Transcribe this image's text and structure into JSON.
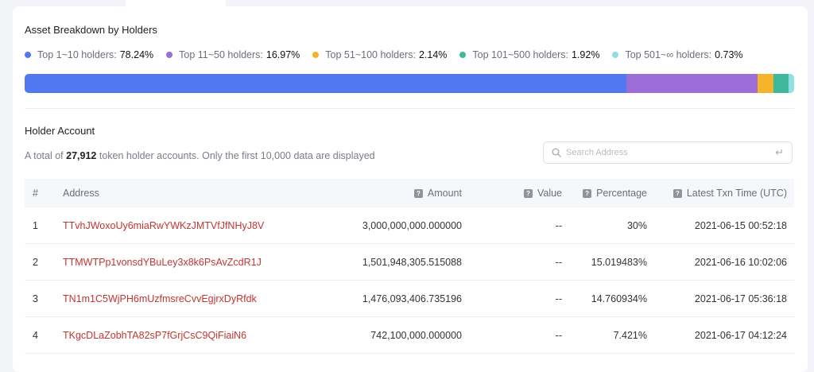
{
  "section1": {
    "title": "Asset Breakdown by Holders"
  },
  "legend": [
    {
      "label": "Top 1~10 holders:",
      "value": "78.24%",
      "color": "#5079f1",
      "pct": 78.24
    },
    {
      "label": "Top 11~50 holders:",
      "value": "16.97%",
      "color": "#9b6dd6",
      "pct": 16.97
    },
    {
      "label": "Top 51~100 holders:",
      "value": "2.14%",
      "color": "#f4b32a",
      "pct": 2.14
    },
    {
      "label": "Top 101~500 holders:",
      "value": "1.92%",
      "color": "#3db89a",
      "pct": 1.92
    },
    {
      "label": "Top 501~∞ holders:",
      "value": "0.73%",
      "color": "#8fdfe3",
      "pct": 0.73
    }
  ],
  "section2": {
    "title": "Holder Account",
    "total_prefix": "A total of",
    "total_count": "27,912",
    "total_suffix": "token holder accounts. Only the first 10,000 data are displayed"
  },
  "search": {
    "placeholder": "Search Address",
    "icon": "search-icon",
    "enter_icon": "enter-icon"
  },
  "table": {
    "headers": {
      "index": "#",
      "address": "Address",
      "amount": "Amount",
      "value": "Value",
      "percentage": "Percentage",
      "time": "Latest Txn Time (UTC)"
    },
    "help_glyph": "?",
    "rows": [
      {
        "index": "1",
        "address": "TTvhJWoxoUy6miaRwYWKzJMTVfJfNHyJ8V",
        "amount": "3,000,000,000.000000",
        "value": "--",
        "percentage": "30%",
        "time": "2021-06-15 00:52:18"
      },
      {
        "index": "2",
        "address": "TTMWTPp1vonsdYBuLey3x8k6PsAvZcdR1J",
        "amount": "1,501,948,305.515088",
        "value": "--",
        "percentage": "15.019483%",
        "time": "2021-06-16 10:02:06"
      },
      {
        "index": "3",
        "address": "TN1m1C5WjPH6mUzfmsreCvvEgjrxDyRfdk",
        "amount": "1,476,093,406.735196",
        "value": "--",
        "percentage": "14.760934%",
        "time": "2021-06-17 05:36:18"
      },
      {
        "index": "4",
        "address": "TKgcDLaZobhTA82sP7fGrjCsC9QiFiaiN6",
        "amount": "742,100,000.000000",
        "value": "--",
        "percentage": "7.421%",
        "time": "2021-06-17 04:12:24"
      }
    ]
  }
}
